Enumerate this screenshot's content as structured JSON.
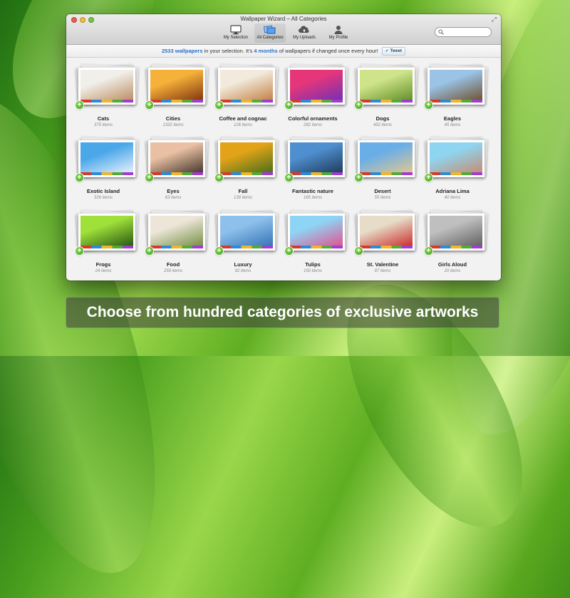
{
  "window": {
    "title": "Wallpaper Wizard – All Categories"
  },
  "toolbar": {
    "items": [
      {
        "label": "My Selection",
        "icon": "monitor-icon",
        "active": false
      },
      {
        "label": "All Categories",
        "icon": "categories-icon",
        "active": true
      },
      {
        "label": "My Uploads",
        "icon": "cloud-upload-icon",
        "active": false
      },
      {
        "label": "My Profile",
        "icon": "user-icon",
        "active": false
      }
    ]
  },
  "search": {
    "icon": "search-icon",
    "placeholder": ""
  },
  "infobar": {
    "count": "2533 wallpapers",
    "text1": " in your selection. It's ",
    "duration": "4 months",
    "text2": " of wallpapers if changed once every hour! ",
    "tweet_label": "Tweet"
  },
  "categories": [
    {
      "name": "Cats",
      "count": "375 items",
      "colors": [
        "#f1efe9",
        "#b8875a"
      ]
    },
    {
      "name": "Cities",
      "count": "1332 items",
      "colors": [
        "#f6b13a",
        "#7a2d0c"
      ]
    },
    {
      "name": "Coffee and cognac",
      "count": "126 items",
      "colors": [
        "#f2eadc",
        "#c07a3c"
      ]
    },
    {
      "name": "Colorful ornaments",
      "count": "282 items",
      "colors": [
        "#e6367a",
        "#6c2fb8"
      ]
    },
    {
      "name": "Dogs",
      "count": "452 items",
      "colors": [
        "#cfe48a",
        "#5b8a20"
      ]
    },
    {
      "name": "Eagles",
      "count": "45 items",
      "colors": [
        "#9ac3e6",
        "#6d4a24"
      ]
    },
    {
      "name": "Exotic Island",
      "count": "316 items",
      "colors": [
        "#4aa7e8",
        "#f2f6ff"
      ]
    },
    {
      "name": "Eyes",
      "count": "63 items",
      "colors": [
        "#e9c0a3",
        "#3a2d24"
      ]
    },
    {
      "name": "Fall",
      "count": "139 items",
      "colors": [
        "#e2a318",
        "#3e6c1a"
      ]
    },
    {
      "name": "Fantastic nature",
      "count": "165 items",
      "colors": [
        "#4f8fcf",
        "#1c3552"
      ]
    },
    {
      "name": "Desert",
      "count": "55 items",
      "colors": [
        "#6aaee8",
        "#e9c98a"
      ]
    },
    {
      "name": "Adriana Lima",
      "count": "40 items",
      "colors": [
        "#8fd4f0",
        "#c9886a"
      ]
    },
    {
      "name": "Frogs",
      "count": "24 items",
      "colors": [
        "#9fe03a",
        "#1f4d10"
      ]
    },
    {
      "name": "Food",
      "count": "259 items",
      "colors": [
        "#ece5d8",
        "#6d8a38"
      ]
    },
    {
      "name": "Luxury",
      "count": "92 items",
      "colors": [
        "#8ec0ec",
        "#2f6fb2"
      ]
    },
    {
      "name": "Tulips",
      "count": "150 items",
      "colors": [
        "#8ed4f4",
        "#e84a8a"
      ]
    },
    {
      "name": "St. Valentine",
      "count": "87 items",
      "colors": [
        "#e6dcc8",
        "#c9201e"
      ]
    },
    {
      "name": "Girls Aloud",
      "count": "20 items",
      "colors": [
        "#bfbfbf",
        "#5a5a5a"
      ]
    }
  ],
  "caption": "Choose from hundred categories of exclusive artworks"
}
